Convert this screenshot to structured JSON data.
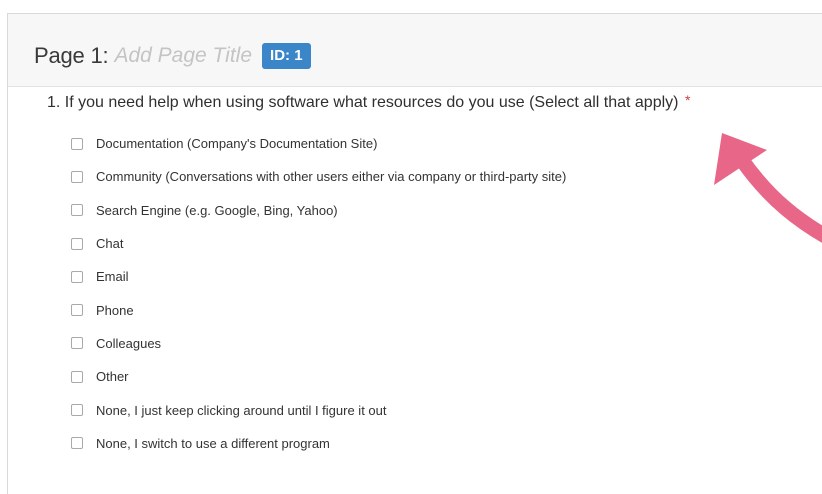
{
  "page": {
    "label": "Page 1:",
    "title_placeholder": "Add Page Title",
    "id_badge": "ID: 1"
  },
  "question": {
    "text": "1. If you need help when using software what resources do you use (Select all that apply)",
    "required_marker": "*",
    "options": [
      {
        "label": "Documentation (Company's Documentation Site)",
        "checked": false
      },
      {
        "label": "Community (Conversations with other users either via company or third-party site)",
        "checked": false
      },
      {
        "label": "Search Engine (e.g. Google, Bing, Yahoo)",
        "checked": false
      },
      {
        "label": "Chat",
        "checked": false
      },
      {
        "label": "Email",
        "checked": false
      },
      {
        "label": "Phone",
        "checked": false
      },
      {
        "label": "Colleagues",
        "checked": false
      },
      {
        "label": "Other",
        "checked": false
      },
      {
        "label": "None, I just keep clicking around until I figure it out",
        "checked": false
      },
      {
        "label": "None, I switch to use a different program",
        "checked": false
      }
    ]
  },
  "colors": {
    "id_badge": "#3a86c8",
    "required": "#d23b3b",
    "annotation_arrow": "#e86789"
  },
  "annotation": {
    "icon": "curved-arrow-icon"
  }
}
